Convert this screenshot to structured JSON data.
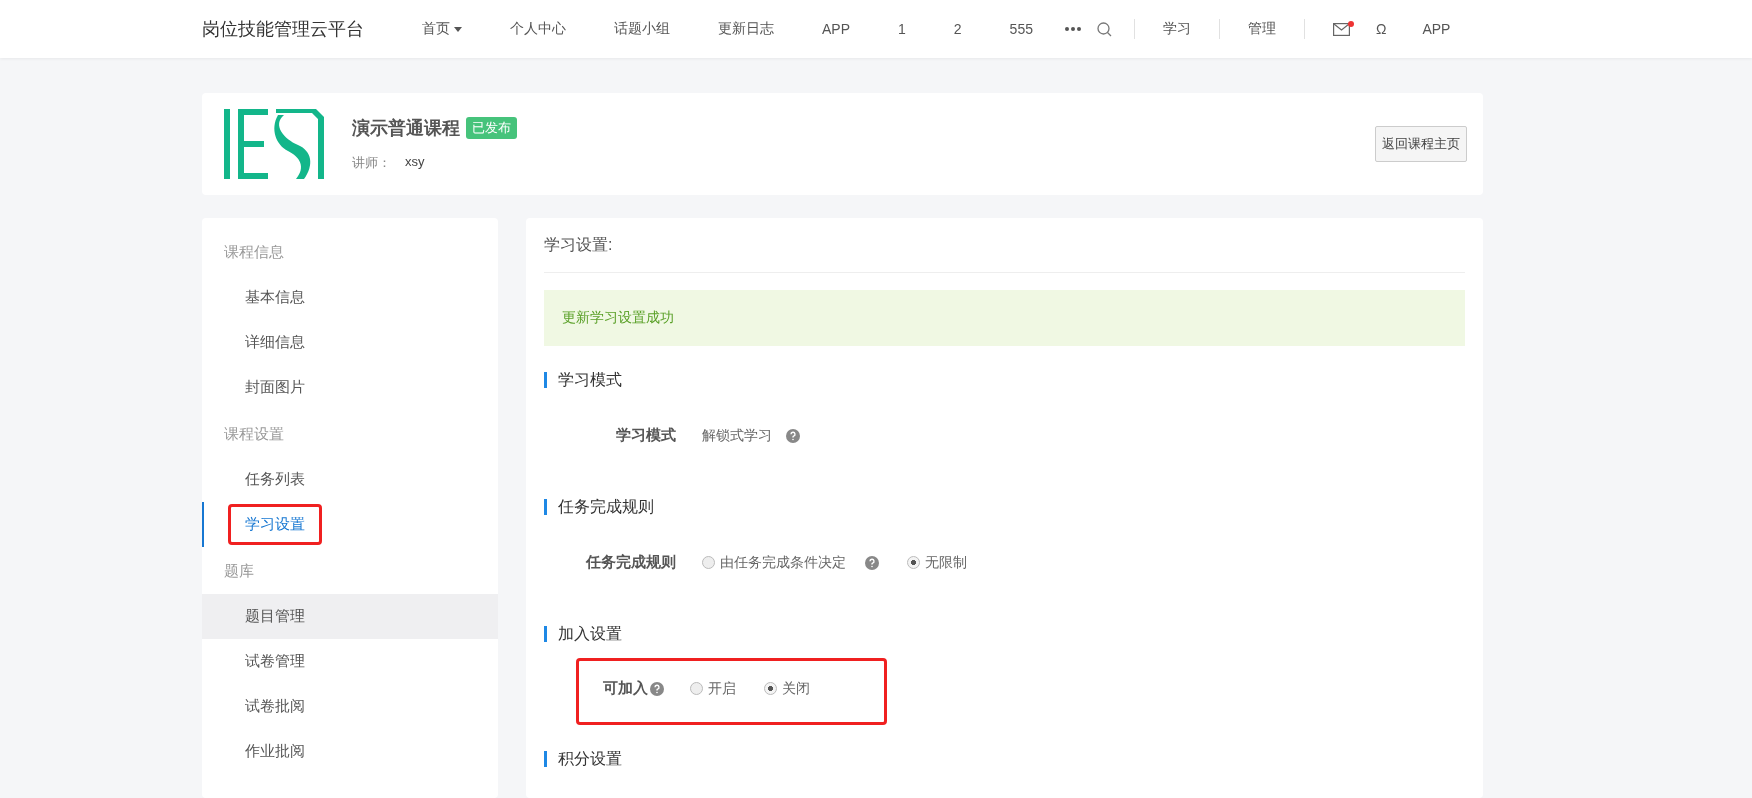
{
  "nav": {
    "brand": "岗位技能管理云平台",
    "items": [
      {
        "kind": "dropdown",
        "label": "首页"
      },
      {
        "kind": "link",
        "label": "个人中心"
      },
      {
        "kind": "link",
        "label": "话题小组"
      },
      {
        "kind": "link",
        "label": "更新日志"
      },
      {
        "kind": "link",
        "label": "APP"
      },
      {
        "kind": "link",
        "label": "1"
      },
      {
        "kind": "link",
        "label": "2"
      },
      {
        "kind": "link",
        "label": "555"
      },
      {
        "kind": "more"
      },
      {
        "kind": "search"
      },
      {
        "kind": "divider"
      },
      {
        "kind": "link",
        "label": "学习"
      },
      {
        "kind": "divider"
      },
      {
        "kind": "link",
        "label": "管理"
      },
      {
        "kind": "divider"
      },
      {
        "kind": "mail",
        "unread": true
      },
      {
        "kind": "glyph",
        "label": "Ω"
      },
      {
        "kind": "link",
        "label": "APP"
      }
    ]
  },
  "course": {
    "title": "演示普通课程",
    "status": "已发布",
    "teacher_label": "讲师：",
    "teacher": "xsy",
    "back_button": "返回课程主页"
  },
  "sidebar": {
    "groups": [
      {
        "title": "课程信息",
        "items": [
          {
            "label": "基本信息",
            "selected": false,
            "hovered": false,
            "annotated": false
          },
          {
            "label": "详细信息",
            "selected": false,
            "hovered": false,
            "annotated": false
          },
          {
            "label": "封面图片",
            "selected": false,
            "hovered": false,
            "annotated": false
          }
        ]
      },
      {
        "title": "课程设置",
        "items": [
          {
            "label": "任务列表",
            "selected": false,
            "hovered": false,
            "annotated": false
          },
          {
            "label": "学习设置",
            "selected": true,
            "hovered": false,
            "annotated": true
          }
        ]
      },
      {
        "title": "题库",
        "items": [
          {
            "label": "题目管理",
            "selected": false,
            "hovered": true,
            "annotated": false
          },
          {
            "label": "试卷管理",
            "selected": false,
            "hovered": false,
            "annotated": false
          },
          {
            "label": "试卷批阅",
            "selected": false,
            "hovered": false,
            "annotated": false
          },
          {
            "label": "作业批阅",
            "selected": false,
            "hovered": false,
            "annotated": false
          }
        ]
      }
    ]
  },
  "main": {
    "title": "学习设置:",
    "alert": "更新学习设置成功",
    "sections": [
      {
        "title": "学习模式",
        "rows": [
          {
            "annotated": false,
            "kind": "text",
            "label": "学习模式",
            "label_help": false,
            "value": "解锁式学习",
            "help": true
          }
        ]
      },
      {
        "title": "任务完成规则",
        "rows": [
          {
            "annotated": false,
            "kind": "radio",
            "label": "任务完成规则",
            "label_help": false,
            "options": [
              {
                "label": "由任务完成条件决定",
                "selected": false,
                "help": true
              },
              {
                "label": "无限制",
                "selected": true,
                "help": false
              }
            ]
          }
        ]
      },
      {
        "title": "加入设置",
        "rows": [
          {
            "annotated": true,
            "kind": "radio",
            "label": "可加入",
            "label_help": true,
            "options": [
              {
                "label": "开启",
                "selected": false,
                "help": false
              },
              {
                "label": "关闭",
                "selected": true,
                "help": false
              }
            ]
          }
        ]
      },
      {
        "title": "积分设置"
      }
    ]
  }
}
